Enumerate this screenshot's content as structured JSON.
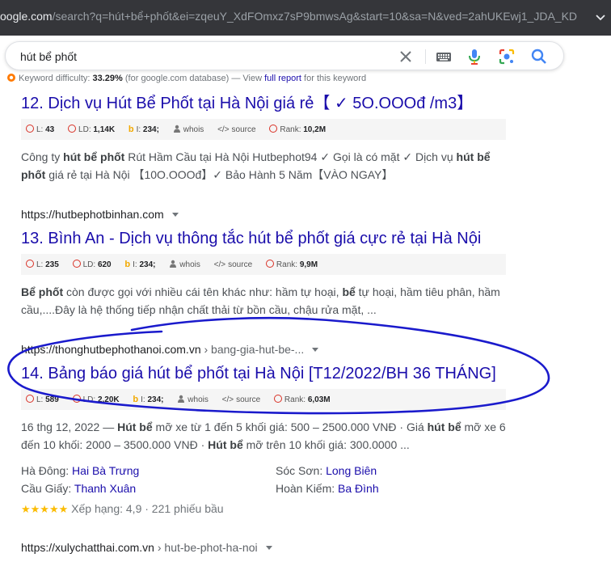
{
  "browser": {
    "url_host": "oogle.com",
    "url_path": "/search?q=hút+bể+phốt&ei=zqeuY_XdFOmxz7sP9bmwsAg&start=10&sa=N&ved=2ahUKEwj1_JDA_KD..."
  },
  "search": {
    "query": "hút bể phốt"
  },
  "keyword_bar": {
    "label": "Keyword difficulty:",
    "value": "33.29%",
    "source": "(for google.com database) — View",
    "link": "full report",
    "suffix": "for this keyword"
  },
  "results": [
    {
      "number": "12.",
      "url": "",
      "title": "Dịch vụ Hút Bể Phốt tại Hà Nội giá rẻ【 ✓ 5O.OOOđ /m3】",
      "meta": {
        "l": "43",
        "ld": "1,14K",
        "i": "234;",
        "whois": "whois",
        "source": "source",
        "rank": "10,2M"
      },
      "snippet_html": "Công ty <b>hút bể phốt</b> Rút Hầm Cầu tại Hà Nội Hutbephot94 ✓ Gọi là có mặt ✓ Dịch vụ <b>hút bể phốt</b> giá rẻ tại Hà Nội 【10O.OOOđ】✓ Bảo Hành 5 Năm【VÀO NGAY】"
    },
    {
      "number": "13.",
      "url": "https://hutbephotbinhan.com",
      "title": "Bình An - Dịch vụ thông tắc hút bể phốt giá cực rẻ tại Hà Nội",
      "meta": {
        "l": "235",
        "ld": "620",
        "i": "234;",
        "whois": "whois",
        "source": "source",
        "rank": "9,9M"
      },
      "snippet_html": "<b>Bể phốt</b> còn được gọi với nhiều cái tên khác như: hầm tự hoại, <b>bể</b> tự hoại, hầm tiêu phân, hầm cầu,....Đây là hệ thống tiếp nhận chất thải từ bồn cầu, chậu rửa mặt, ..."
    },
    {
      "number": "14.",
      "url": "https://thonghutbephothanoi.com.vn",
      "crumb": "› bang-gia-hut-be-...",
      "title": "Bảng báo giá hút bể phốt tại Hà Nội [T12/2022/BH 36 THÁNG]",
      "meta": {
        "l": "589",
        "ld": "2,20K",
        "i": "234;",
        "whois": "whois",
        "source": "source",
        "rank": "6,03M"
      },
      "snippet_html": "16 thg 12, 2022 — <b>Hút bể</b> mỡ xe từ 1 đến 5 khối giá: 500 – 2500.000 VNĐ · Giá <b>hút bể</b> mỡ xe 6 đến 10 khối: 2000 – 3500.000 VNĐ · <b>Hút bể</b> mỡ trên 10 khối giá: 300.0000 ...",
      "sitelinks": [
        {
          "prefix": "Hà Đông:",
          "link": "Hai Bà Trưng"
        },
        {
          "prefix": "Sóc Sơn:",
          "link": "Long Biên"
        },
        {
          "prefix": "Cầu Giấy:",
          "link": "Thanh Xuân"
        },
        {
          "prefix": "Hoàn Kiếm:",
          "link": "Ba Đình"
        }
      ],
      "rating": {
        "stars": "★★★★★",
        "text": "Xếp hạng: 4,9 · 221 phiếu bầu"
      }
    },
    {
      "number": "",
      "url": "https://xulychatthai.com.vn",
      "crumb": "› hut-be-phot-ha-noi"
    }
  ],
  "meta_labels": {
    "l": "L:",
    "ld": "LD:",
    "i": "I:",
    "rank": "Rank:"
  },
  "colors": {
    "link": "#1a0dab",
    "annotation": "#1a1acc",
    "rank_icon": "#d93025"
  }
}
